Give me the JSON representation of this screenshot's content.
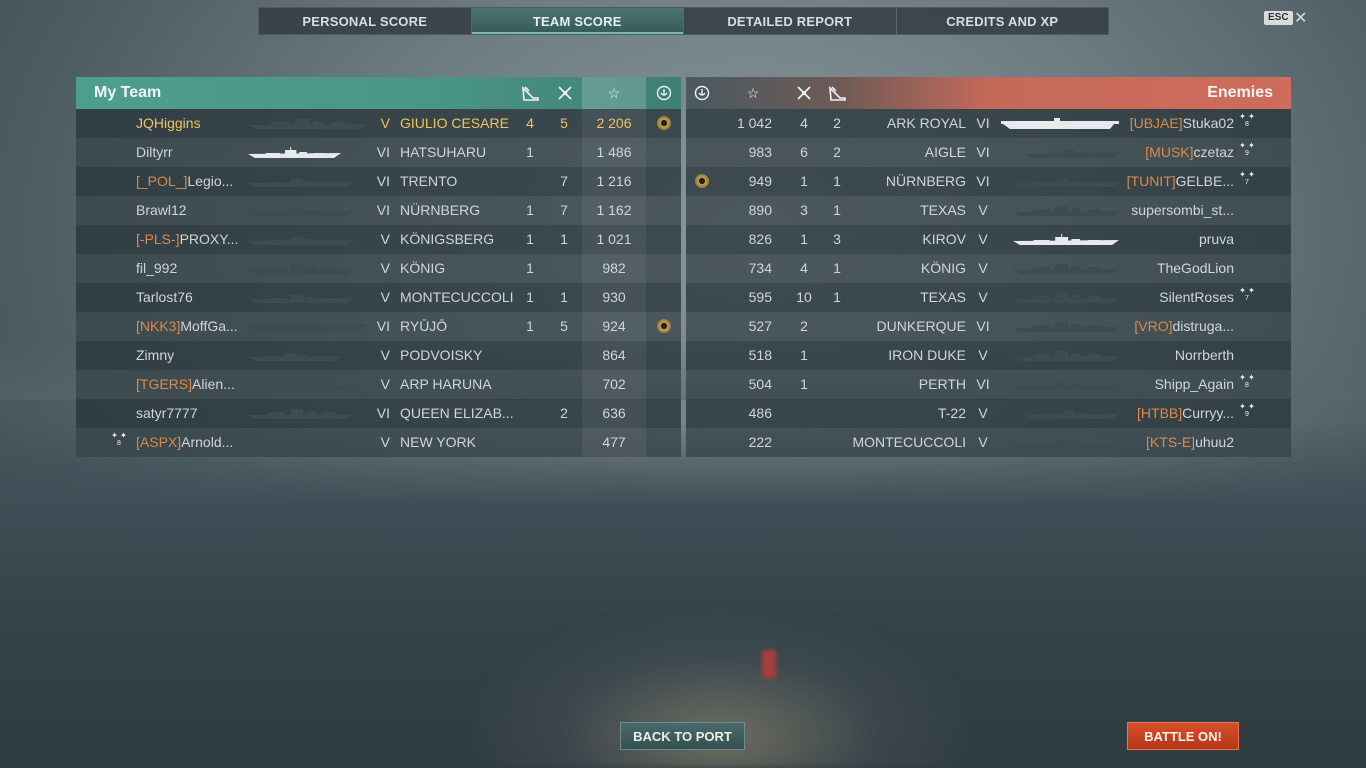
{
  "tabs": [
    {
      "label": "PERSONAL SCORE",
      "active": false
    },
    {
      "label": "TEAM SCORE",
      "active": true
    },
    {
      "label": "DETAILED REPORT",
      "active": false
    },
    {
      "label": "CREDITS AND XP",
      "active": false
    }
  ],
  "esc_label": "ESC",
  "close_glyph": "✕",
  "colors": {
    "my_team": "#4e9e8f",
    "enemies": "#cf6c5c",
    "highlight": "#f0c35e",
    "clan": "#d98b4a",
    "battle_button": "#c8401f"
  },
  "my_team": {
    "title": "My Team",
    "header_icons": [
      "plane-kill-icon",
      "kill-icon",
      "star-icon",
      "base-capture-icon"
    ],
    "rows": [
      {
        "clan": "",
        "player": "JQHiggins",
        "tier": "V",
        "ship": "GIULIO CESARE",
        "planes": "4",
        "kills": "5",
        "score": "2 206",
        "medal": true,
        "me": true,
        "stars": "",
        "ship_type": "bb-long"
      },
      {
        "clan": "",
        "player": "Diltyrr",
        "tier": "VI",
        "ship": "HATSUHARU",
        "planes": "1",
        "kills": "",
        "score": "1 486",
        "medal": false,
        "me": false,
        "stars": "",
        "ship_type": "dd-white"
      },
      {
        "clan": "[_POL_]",
        "player": "Legio...",
        "tier": "VI",
        "ship": "TRENTO",
        "planes": "",
        "kills": "7",
        "score": "1 216",
        "medal": false,
        "me": false,
        "stars": "",
        "ship_type": "ca"
      },
      {
        "clan": "",
        "player": "Brawl12",
        "tier": "VI",
        "ship": "NÜRNBERG",
        "planes": "1",
        "kills": "7",
        "score": "1 162",
        "medal": false,
        "me": false,
        "stars": "",
        "ship_type": "ca"
      },
      {
        "clan": "[-PLS-]",
        "player": "PROXY...",
        "tier": "V",
        "ship": "KÖNIGSBERG",
        "planes": "1",
        "kills": "1",
        "score": "1 021",
        "medal": false,
        "me": false,
        "stars": "",
        "ship_type": "ca"
      },
      {
        "clan": "",
        "player": "fil_992",
        "tier": "V",
        "ship": "KÖNIG",
        "planes": "1",
        "kills": "",
        "score": "982",
        "medal": false,
        "me": false,
        "stars": "",
        "ship_type": "bb"
      },
      {
        "clan": "",
        "player": "Tarlost76",
        "tier": "V",
        "ship": "MONTECUCCOLI",
        "planes": "1",
        "kills": "1",
        "score": "930",
        "medal": false,
        "me": false,
        "stars": "",
        "ship_type": "ca"
      },
      {
        "clan": "[NKK3]",
        "player": "MoffGa...",
        "tier": "VI",
        "ship": "RYŪJŌ",
        "planes": "1",
        "kills": "5",
        "score": "924",
        "medal": true,
        "me": false,
        "stars": "",
        "ship_type": "cv"
      },
      {
        "clan": "",
        "player": "Zimny",
        "tier": "V",
        "ship": "PODVOISKY",
        "planes": "",
        "kills": "",
        "score": "864",
        "medal": false,
        "me": false,
        "stars": "",
        "ship_type": "dd"
      },
      {
        "clan": "[TGERS]",
        "player": "Alien...",
        "tier": "V",
        "ship": "ARP HARUNA",
        "planes": "",
        "kills": "",
        "score": "702",
        "medal": false,
        "me": false,
        "stars": "",
        "ship_type": "bb"
      },
      {
        "clan": "",
        "player": "satyr7777",
        "tier": "VI",
        "ship": "QUEEN ELIZAB...",
        "planes": "",
        "kills": "2",
        "score": "636",
        "medal": false,
        "me": false,
        "stars": "",
        "ship_type": "bb"
      },
      {
        "clan": "[ASPX]",
        "player": "Arnold...",
        "tier": "V",
        "ship": "NEW YORK",
        "planes": "",
        "kills": "",
        "score": "477",
        "medal": false,
        "me": false,
        "stars": "8",
        "ship_type": "bb-long"
      }
    ]
  },
  "enemies": {
    "title": "Enemies",
    "header_icons": [
      "base-capture-icon",
      "star-icon",
      "kill-icon",
      "plane-kill-icon"
    ],
    "rows": [
      {
        "clan": "[UBJAE]",
        "player": "Stuka02",
        "tier": "VI",
        "ship": "ARK ROYAL",
        "planes": "2",
        "kills": "4",
        "score": "1 042",
        "medal": false,
        "stars": "8",
        "ship_type": "cv-white"
      },
      {
        "clan": "[MUSK]",
        "player": "czetaz",
        "tier": "VI",
        "ship": "AIGLE",
        "planes": "2",
        "kills": "6",
        "score": "983",
        "medal": false,
        "stars": "9",
        "ship_type": "dd"
      },
      {
        "clan": "[TUNIT]",
        "player": "GELBE...",
        "tier": "VI",
        "ship": "NÜRNBERG",
        "planes": "1",
        "kills": "1",
        "score": "949",
        "medal": true,
        "stars": "7",
        "ship_type": "ca"
      },
      {
        "clan": "",
        "player": "supersombi_st...",
        "tier": "V",
        "ship": "TEXAS",
        "planes": "1",
        "kills": "3",
        "score": "890",
        "medal": false,
        "stars": "",
        "ship_type": "bb"
      },
      {
        "clan": "",
        "player": "pruva",
        "tier": "V",
        "ship": "KIROV",
        "planes": "3",
        "kills": "1",
        "score": "826",
        "medal": false,
        "stars": "",
        "ship_type": "ca-white"
      },
      {
        "clan": "",
        "player": "TheGodLion",
        "tier": "V",
        "ship": "KÖNIG",
        "planes": "1",
        "kills": "4",
        "score": "734",
        "medal": false,
        "stars": "",
        "ship_type": "bb"
      },
      {
        "clan": "",
        "player": "SilentRoses",
        "tier": "V",
        "ship": "TEXAS",
        "planes": "1",
        "kills": "10",
        "score": "595",
        "medal": false,
        "stars": "7",
        "ship_type": "bb"
      },
      {
        "clan": "[VRO]",
        "player": "distruga...",
        "tier": "VI",
        "ship": "DUNKERQUE",
        "planes": "",
        "kills": "2",
        "score": "527",
        "medal": false,
        "stars": "",
        "ship_type": "bb"
      },
      {
        "clan": "",
        "player": "Norrberth",
        "tier": "V",
        "ship": "IRON DUKE",
        "planes": "",
        "kills": "1",
        "score": "518",
        "medal": false,
        "stars": "",
        "ship_type": "bb"
      },
      {
        "clan": "",
        "player": "Shipp_Again",
        "tier": "VI",
        "ship": "PERTH",
        "planes": "",
        "kills": "1",
        "score": "504",
        "medal": false,
        "stars": "8",
        "ship_type": "ca"
      },
      {
        "clan": "[HTBB]",
        "player": "Curryy...",
        "tier": "V",
        "ship": "T-22",
        "planes": "",
        "kills": "",
        "score": "486",
        "medal": false,
        "stars": "9",
        "ship_type": "dd"
      },
      {
        "clan": "[KTS-E]",
        "player": "uhuu2",
        "tier": "V",
        "ship": "MONTECUCCOLI",
        "planes": "",
        "kills": "",
        "score": "222",
        "medal": false,
        "stars": "",
        "ship_type": "ca"
      }
    ]
  },
  "buttons": {
    "back": "BACK TO PORT",
    "battle": "BATTLE ON!"
  }
}
